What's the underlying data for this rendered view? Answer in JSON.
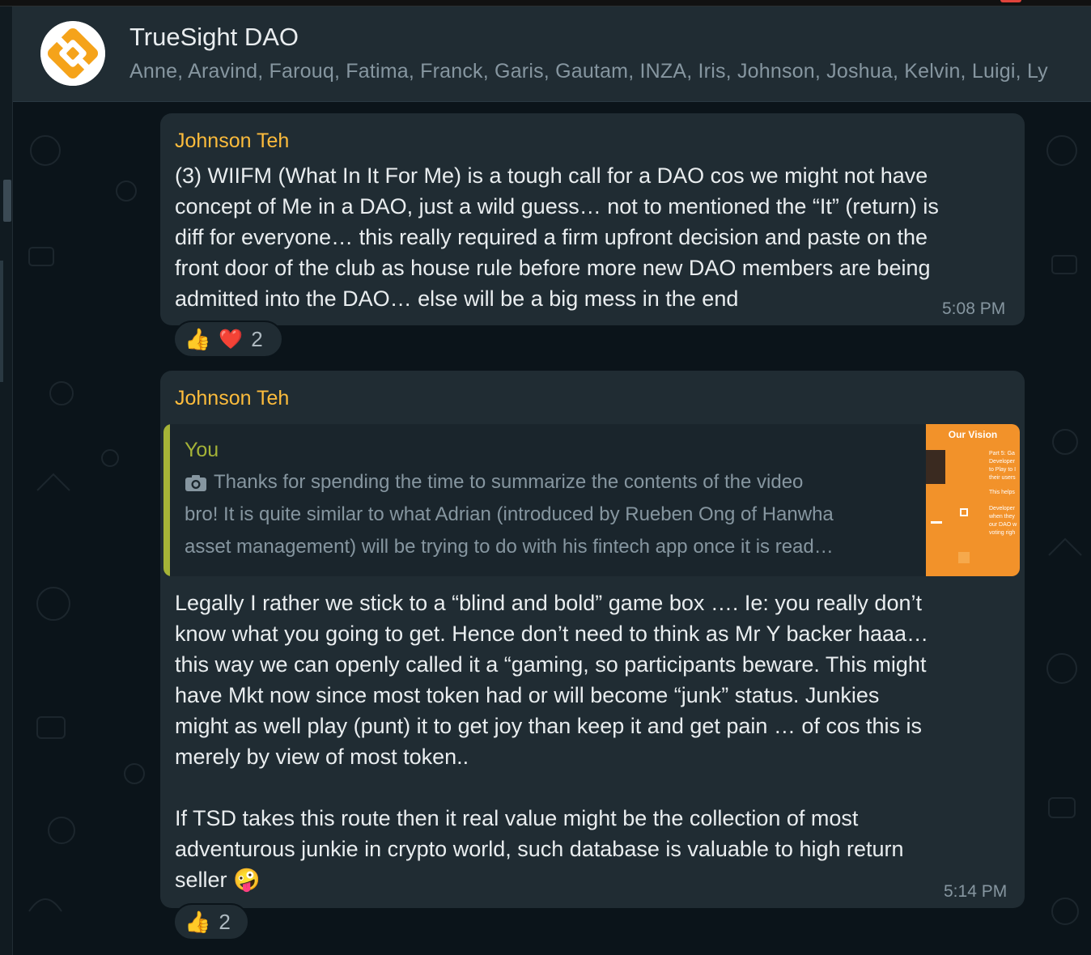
{
  "header": {
    "title": "TrueSight DAO",
    "members": "Anne, Aravind, Farouq, Fatima, Franck, Garis, Gautam, INZA, Iris, Johnson, Joshua, Kelvin, Luigi, Ly"
  },
  "messages": [
    {
      "sender": "Johnson Teh",
      "lines": [
        "(3) WIIFM (What In It For Me) is a tough call for a DAO cos we might not have",
        "concept of Me in a DAO, just a wild guess… not to mentioned the “It” (return) is",
        "diff for everyone… this really required a firm upfront decision and paste on the",
        "front door of the club as house rule before more new DAO members are being",
        "admitted into the DAO… else will be a big mess in the end"
      ],
      "time": "5:08 PM",
      "reactions": {
        "emojis": [
          "👍",
          "❤️"
        ],
        "count": "2"
      }
    },
    {
      "sender": "Johnson Teh",
      "quote": {
        "author": "You",
        "lines": [
          "Thanks for spending the time to summarize the contents of the video",
          "bro! It is quite similar to what Adrian (introduced by Rueben Ong of Hanwha",
          "asset management) will be trying to do with his fintech app once it is read…"
        ],
        "thumbnail": {
          "title": "Our Vision",
          "snippets": [
            "Part 5: Ga",
            "Developer",
            "to Play to I",
            "their users",
            "This helps",
            "Developer",
            "when they",
            "our DAO w",
            "voting righ"
          ]
        }
      },
      "lines": [
        "Legally I rather we stick to a “blind and bold” game box …. Ie: you really don’t",
        "know what you going to get. Hence don’t need to think as Mr Y backer haaa…",
        "this way we can openly called it a “gaming, so participants beware. This might",
        "have Mkt now since most token had or will become “junk” status. Junkies",
        "might as well play (punt) it to get joy than keep it and get pain … of cos this is",
        "merely by view of most token..",
        "",
        "If TSD takes this route then it real value might be the collection of most",
        "adventurous junkie in crypto world, such database is valuable to high return",
        "seller 🤪"
      ],
      "time": "5:14 PM",
      "reactions": {
        "emojis": [
          "👍"
        ],
        "count": "2"
      }
    }
  ],
  "colors": {
    "sender": "#fdbc3c",
    "quote_author": "#a5b337",
    "bubble": "#202c33",
    "background": "#0b141a",
    "header": "#202c33"
  },
  "icons": [
    "truesight-logo",
    "camera-icon",
    "thumbs-up-emoji",
    "heart-emoji",
    "zany-face-emoji"
  ]
}
